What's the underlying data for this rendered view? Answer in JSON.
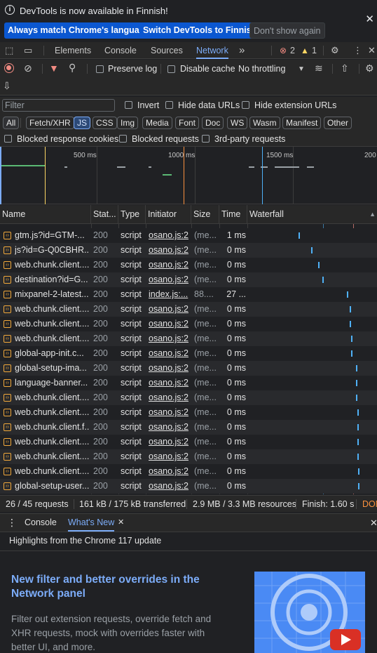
{
  "infobar": {
    "message": "DevTools is now available in Finnish!",
    "btn_match": "Always match Chrome's language",
    "btn_switch": "Switch DevTools to Finnish",
    "btn_dismiss": "Don't show again",
    "close": "✕"
  },
  "tabs": {
    "elements": "Elements",
    "console": "Console",
    "sources": "Sources",
    "network": "Network",
    "more": "»",
    "errors": "2",
    "warnings": "1"
  },
  "toolbar": {
    "preserve_log": "Preserve log",
    "disable_cache": "Disable cache",
    "throttling": "No throttling"
  },
  "filter": {
    "placeholder": "Filter",
    "invert": "Invert",
    "hide_data_urls": "Hide data URLs",
    "hide_extension_urls": "Hide extension URLs"
  },
  "type_filters": [
    "All",
    "Fetch/XHR",
    "JS",
    "CSS",
    "Img",
    "Media",
    "Font",
    "Doc",
    "WS",
    "Wasm",
    "Manifest",
    "Other"
  ],
  "block": {
    "blocked_cookies": "Blocked response cookies",
    "blocked_requests": "Blocked requests",
    "third_party": "3rd-party requests"
  },
  "overview": {
    "ticks": [
      "500 ms",
      "1000 ms",
      "1500 ms",
      "200"
    ]
  },
  "columns": {
    "name": "Name",
    "status": "Stat...",
    "type": "Type",
    "initiator": "Initiator",
    "size": "Size",
    "time": "Time",
    "waterfall": "Waterfall"
  },
  "requests": [
    {
      "name": "gtm.js?id=GTM-...",
      "status": "200",
      "type": "script",
      "initiator": "osano.js:2",
      "size": "(me...",
      "time": "1 ms",
      "wf": 0.49
    },
    {
      "name": "js?id=G-Q0CBHR...",
      "status": "200",
      "type": "script",
      "initiator": "osano.js:2",
      "size": "(me...",
      "time": "0 ms",
      "wf": 0.61
    },
    {
      "name": "web.chunk.client....",
      "status": "200",
      "type": "script",
      "initiator": "osano.js:2",
      "size": "(me...",
      "time": "0 ms",
      "wf": 0.68
    },
    {
      "name": "destination?id=G...",
      "status": "200",
      "type": "script",
      "initiator": "osano.js:2",
      "size": "(me...",
      "time": "0 ms",
      "wf": 0.72
    },
    {
      "name": "mixpanel-2-latest...",
      "status": "200",
      "type": "script",
      "initiator": "index.js:...",
      "size": "88....",
      "time": "27 ...",
      "wf": 0.95
    },
    {
      "name": "web.chunk.client....",
      "status": "200",
      "type": "script",
      "initiator": "osano.js:2",
      "size": "(me...",
      "time": "0 ms",
      "wf": 0.98
    },
    {
      "name": "web.chunk.client....",
      "status": "200",
      "type": "script",
      "initiator": "osano.js:2",
      "size": "(me...",
      "time": "0 ms",
      "wf": 0.98
    },
    {
      "name": "web.chunk.client....",
      "status": "200",
      "type": "script",
      "initiator": "osano.js:2",
      "size": "(me...",
      "time": "0 ms",
      "wf": 0.99
    },
    {
      "name": "global-app-init.c...",
      "status": "200",
      "type": "script",
      "initiator": "osano.js:2",
      "size": "(me...",
      "time": "0 ms",
      "wf": 0.99
    },
    {
      "name": "global-setup-ima...",
      "status": "200",
      "type": "script",
      "initiator": "osano.js:2",
      "size": "(me...",
      "time": "0 ms",
      "wf": 1.04
    },
    {
      "name": "language-banner...",
      "status": "200",
      "type": "script",
      "initiator": "osano.js:2",
      "size": "(me...",
      "time": "0 ms",
      "wf": 1.04
    },
    {
      "name": "web.chunk.client....",
      "status": "200",
      "type": "script",
      "initiator": "osano.js:2",
      "size": "(me...",
      "time": "0 ms",
      "wf": 1.04
    },
    {
      "name": "web.chunk.client....",
      "status": "200",
      "type": "script",
      "initiator": "osano.js:2",
      "size": "(me...",
      "time": "0 ms",
      "wf": 1.05
    },
    {
      "name": "web.chunk.client.f...",
      "status": "200",
      "type": "script",
      "initiator": "osano.js:2",
      "size": "(me...",
      "time": "0 ms",
      "wf": 1.05
    },
    {
      "name": "web.chunk.client....",
      "status": "200",
      "type": "script",
      "initiator": "osano.js:2",
      "size": "(me...",
      "time": "0 ms",
      "wf": 1.05
    },
    {
      "name": "web.chunk.client....",
      "status": "200",
      "type": "script",
      "initiator": "osano.js:2",
      "size": "(me...",
      "time": "0 ms",
      "wf": 1.05
    },
    {
      "name": "web.chunk.client....",
      "status": "200",
      "type": "script",
      "initiator": "osano.js:2",
      "size": "(me...",
      "time": "0 ms",
      "wf": 1.06
    },
    {
      "name": "global-setup-user...",
      "status": "200",
      "type": "script",
      "initiator": "osano.js:2",
      "size": "(me...",
      "time": "0 ms",
      "wf": 1.06
    }
  ],
  "status": {
    "requests": "26 / 45 requests",
    "transferred": "161 kB / 175 kB transferred",
    "resources": "2.9 MB / 3.3 MB resources",
    "finish": "Finish: 1.60 s",
    "dom": "DOM"
  },
  "drawer": {
    "console_tab": "Console",
    "whats_new_tab": "What's New",
    "highlights": "Highlights from the Chrome 117 update",
    "title": "New filter and better overrides in the Network panel",
    "description": "Filter out extension requests, override fetch and XHR requests, mock with overrides faster with better UI, and more."
  },
  "colors": {
    "accent": "#7cacf8",
    "waterfall_bar": "#4fb1f7",
    "error": "#f28b82",
    "warning": "#fdd663"
  }
}
